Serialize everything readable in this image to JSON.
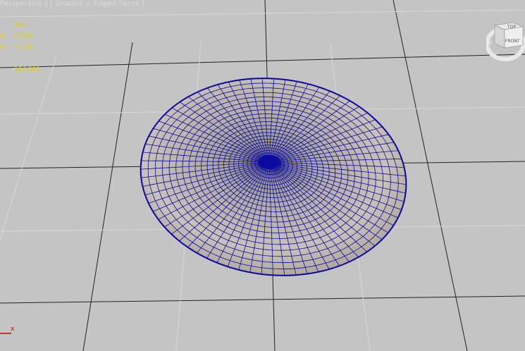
{
  "viewport": {
    "label": "Perspective ] [ Shaded + Edged Faces ]",
    "background": "#c4c4c4",
    "grid_color": "#222222",
    "wire_color": "#0a0aa0"
  },
  "stats": {
    "title": "Total",
    "polys_key": "s:",
    "polys_value": "6,300",
    "verts_key": "s:",
    "verts_value": "4,109",
    "fps_value": "164.903",
    "color": "#e0d000"
  },
  "viewcube": {
    "top_label": "TOP",
    "front_label": "FRONT",
    "left_letter": "W"
  },
  "axis": {
    "x_label": "x",
    "x_color": "#d00000"
  }
}
